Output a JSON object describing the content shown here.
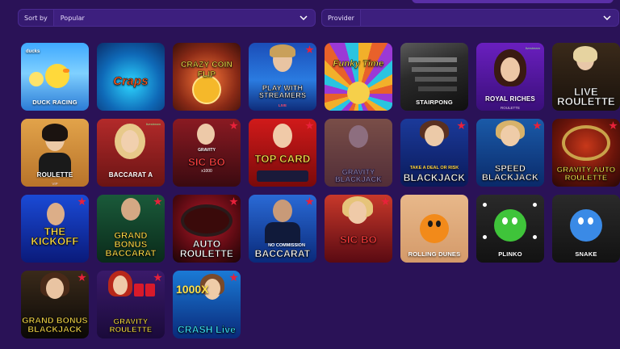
{
  "filters": {
    "sort_label": "Sort by",
    "sort_value": "Popular",
    "provider_label": "Provider",
    "provider_value": ""
  },
  "games": [
    {
      "title": "DUCK RACING",
      "top": "ducks"
    },
    {
      "title": "Craps",
      "top": ""
    },
    {
      "title": "CRAZY COIN FLIP",
      "top": ""
    },
    {
      "title": "PLAY WITH STREAMERS",
      "top": "LIVE"
    },
    {
      "title": "Funky Time",
      "top": ""
    },
    {
      "title": "STAIRPONG",
      "top": ""
    },
    {
      "title": "ROYAL RICHES",
      "sub": "ROULETTE"
    },
    {
      "title": "LIVE ROULETTE",
      "top": ""
    },
    {
      "title": "ROULETTE",
      "sub": "VIP"
    },
    {
      "title": "BACCARAT A",
      "top": ""
    },
    {
      "title": "SIC BO",
      "top": "GRAVITY",
      "sub": "x1000"
    },
    {
      "title": "TOP CARD",
      "top": ""
    },
    {
      "title": "GRAVITY BLACKJACK",
      "top": ""
    },
    {
      "title": "BLACKJACK",
      "top": "TAKE A DEAL OR RISK"
    },
    {
      "title": "SPEED BLACKJACK",
      "top": ""
    },
    {
      "title": "GRAVITY AUTO ROULETTE",
      "top": ""
    },
    {
      "title": "THE KICKOFF",
      "top": ""
    },
    {
      "title": "GRAND BONUS BACCARAT",
      "top": ""
    },
    {
      "title": "AUTO ROULETTE",
      "top": ""
    },
    {
      "title": "BACCARAT",
      "top": "NO COMMISSION"
    },
    {
      "title": "SIC BO",
      "top": ""
    },
    {
      "title": "ROLLING DUNES",
      "top": ""
    },
    {
      "title": "PLINKO",
      "top": ""
    },
    {
      "title": "SNAKE",
      "top": ""
    },
    {
      "title": "GRAND BONUS BLACKJACK",
      "top": ""
    },
    {
      "title": "GRAVITY ROULETTE",
      "top": ""
    },
    {
      "title": "CRASH Live",
      "top": "1000X"
    }
  ],
  "colors": {
    "page_bg": "#2a1257",
    "filter_bg": "#3d1f7e",
    "badge": "#e8213a"
  },
  "icons": {
    "chevron": "chevron-down-icon",
    "badge": "star-icon"
  },
  "provider_tags": [
    "livestream"
  ]
}
